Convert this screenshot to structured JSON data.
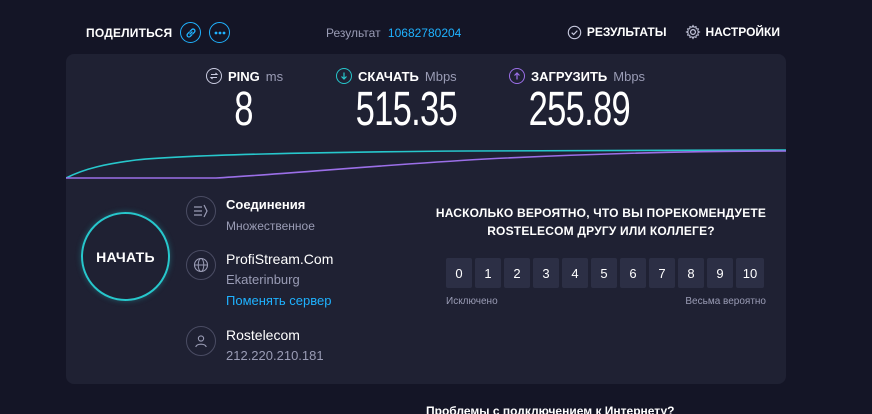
{
  "topbar": {
    "share_label": "ПОДЕЛИТЬСЯ",
    "result_label": "Результат",
    "result_id": "10682780204",
    "results_label": "РЕЗУЛЬТАТЫ",
    "settings_label": "НАСТРОЙКИ"
  },
  "metrics": {
    "ping": {
      "label": "PING",
      "unit": "ms",
      "value": "8"
    },
    "download": {
      "label": "СКАЧАТЬ",
      "unit": "Mbps",
      "value": "515.35"
    },
    "upload": {
      "label": "ЗАГРУЗИТЬ",
      "unit": "Mbps",
      "value": "255.89"
    }
  },
  "go_label": "НАЧАТЬ",
  "connections": {
    "title": "Соединения",
    "value": "Множественное"
  },
  "server": {
    "name": "ProfiStream.Com",
    "city": "Ekaterinburg",
    "change_label": "Поменять сервер"
  },
  "isp": {
    "name": "Rostelecom",
    "ip": "212.220.210.181"
  },
  "survey": {
    "question_line1": "НАСКОЛЬКО ВЕРОЯТНО, ЧТО ВЫ ПОРЕКОМЕНДУЕТЕ",
    "brand": "ROSTELECOM",
    "question_line2_rest": " ДРУГУ ИЛИ КОЛЛЕГЕ?",
    "scale": [
      "0",
      "1",
      "2",
      "3",
      "4",
      "5",
      "6",
      "7",
      "8",
      "9",
      "10"
    ],
    "low_label": "Исключено",
    "high_label": "Весьма вероятно"
  },
  "footer_text": "Проблемы с подключением к Интернету?",
  "colors": {
    "accent": "#1fb2ff",
    "download": "#27c7cc",
    "upload": "#9b6fe8",
    "panel": "#1f2133",
    "background": "#141526"
  }
}
